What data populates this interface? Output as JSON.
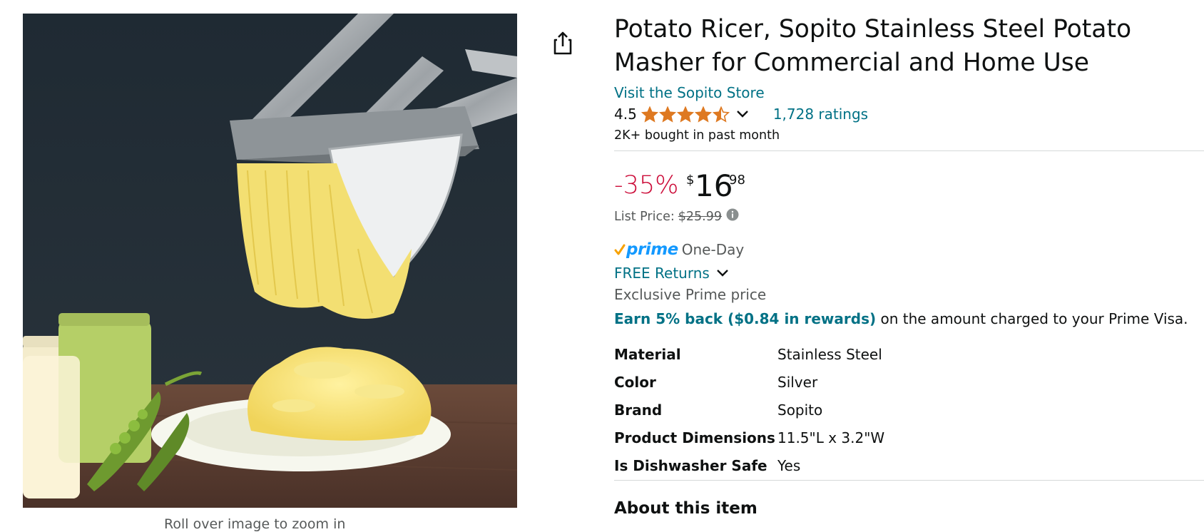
{
  "product": {
    "title": "Potato Ricer, Sopito Stainless Steel Potato Masher for Commercial and Home Use",
    "store_link": "Visit the Sopito Store",
    "rating_value": "4.5",
    "rating_stars": 4.5,
    "ratings_count": "1,728 ratings",
    "bought": "2K+ bought in past month"
  },
  "price": {
    "discount": "-35%",
    "symbol": "$",
    "whole": "16",
    "fraction": "98",
    "list_label": "List Price:",
    "list_value": "$25.99"
  },
  "delivery": {
    "prime_label": "prime",
    "prime_speed": "One-Day",
    "free_returns": "FREE Returns",
    "exclusive": "Exclusive Prime price"
  },
  "rewards": {
    "link": "Earn 5% back ($0.84 in rewards)",
    "text": " on the amount charged to your Prime Visa."
  },
  "specs": [
    {
      "label": "Material",
      "value": "Stainless Steel"
    },
    {
      "label": "Color",
      "value": "Silver"
    },
    {
      "label": "Brand",
      "value": "Sopito"
    },
    {
      "label": "Product Dimensions",
      "value": "11.5\"L x 3.2\"W"
    },
    {
      "label": "Is Dishwasher Safe",
      "value": "Yes"
    }
  ],
  "about_heading": "About this item",
  "image": {
    "zoom_hint": "Roll over image to zoom in"
  },
  "colors": {
    "link": "#007185",
    "discount": "#cc0c39",
    "star": "#de7921",
    "prime_blue": "#1399ff",
    "prime_check": "#f7a100"
  },
  "icons": {
    "share": "share-icon",
    "chevron": "chevron-down-icon",
    "info": "info-icon",
    "prime_check": "prime-check-icon"
  }
}
